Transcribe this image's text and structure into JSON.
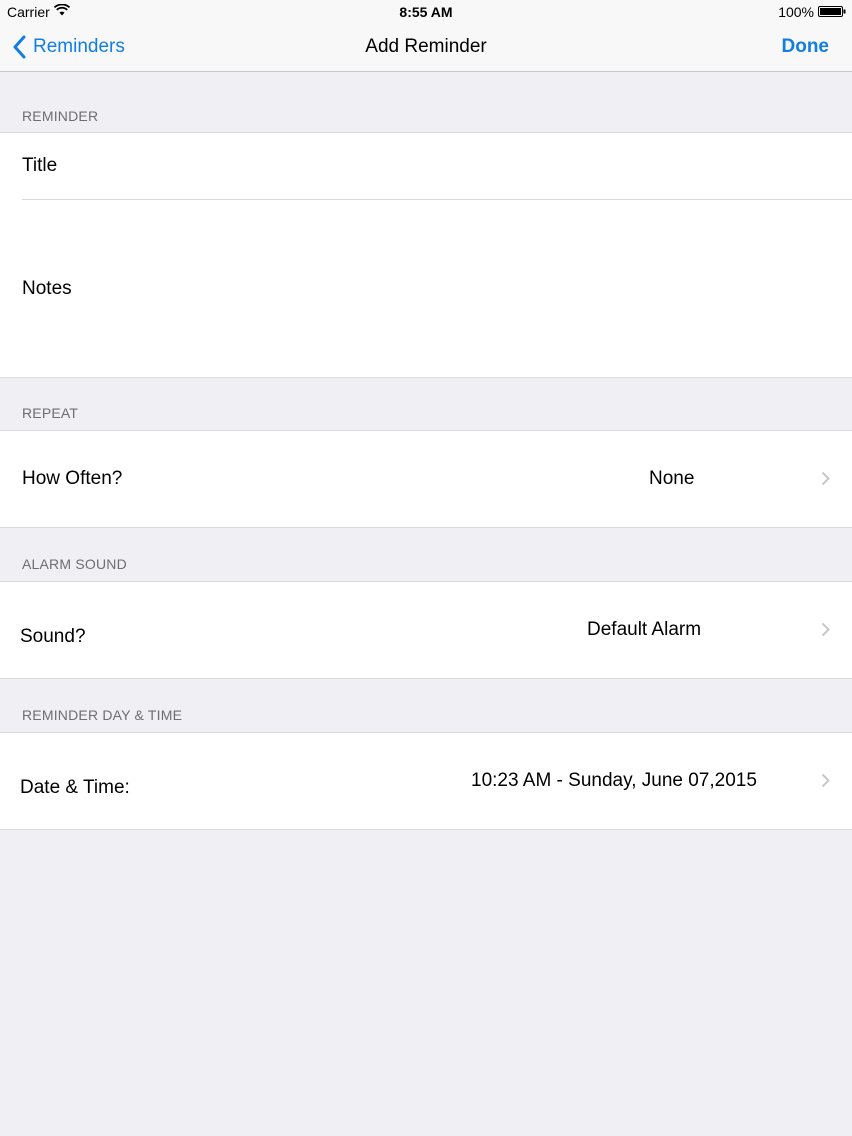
{
  "status_bar": {
    "carrier": "Carrier",
    "time": "8:55 AM",
    "battery": "100%"
  },
  "nav": {
    "back_label": "Reminders",
    "title": "Add Reminder",
    "done_label": "Done",
    "accent_color": "#127ee3"
  },
  "sections": {
    "reminder": {
      "header": "REMINDER",
      "title_label": "Title",
      "notes_label": "Notes"
    },
    "repeat": {
      "header": "REPEAT",
      "label": "How Often?",
      "value": "None"
    },
    "alarm": {
      "header": "ALARM SOUND",
      "label": "Sound?",
      "value": "Default Alarm"
    },
    "day_time": {
      "header": "REMINDER DAY & TIME",
      "label": "Date & Time:",
      "value": "10:23 AM - Sunday, June 07,2015"
    }
  }
}
